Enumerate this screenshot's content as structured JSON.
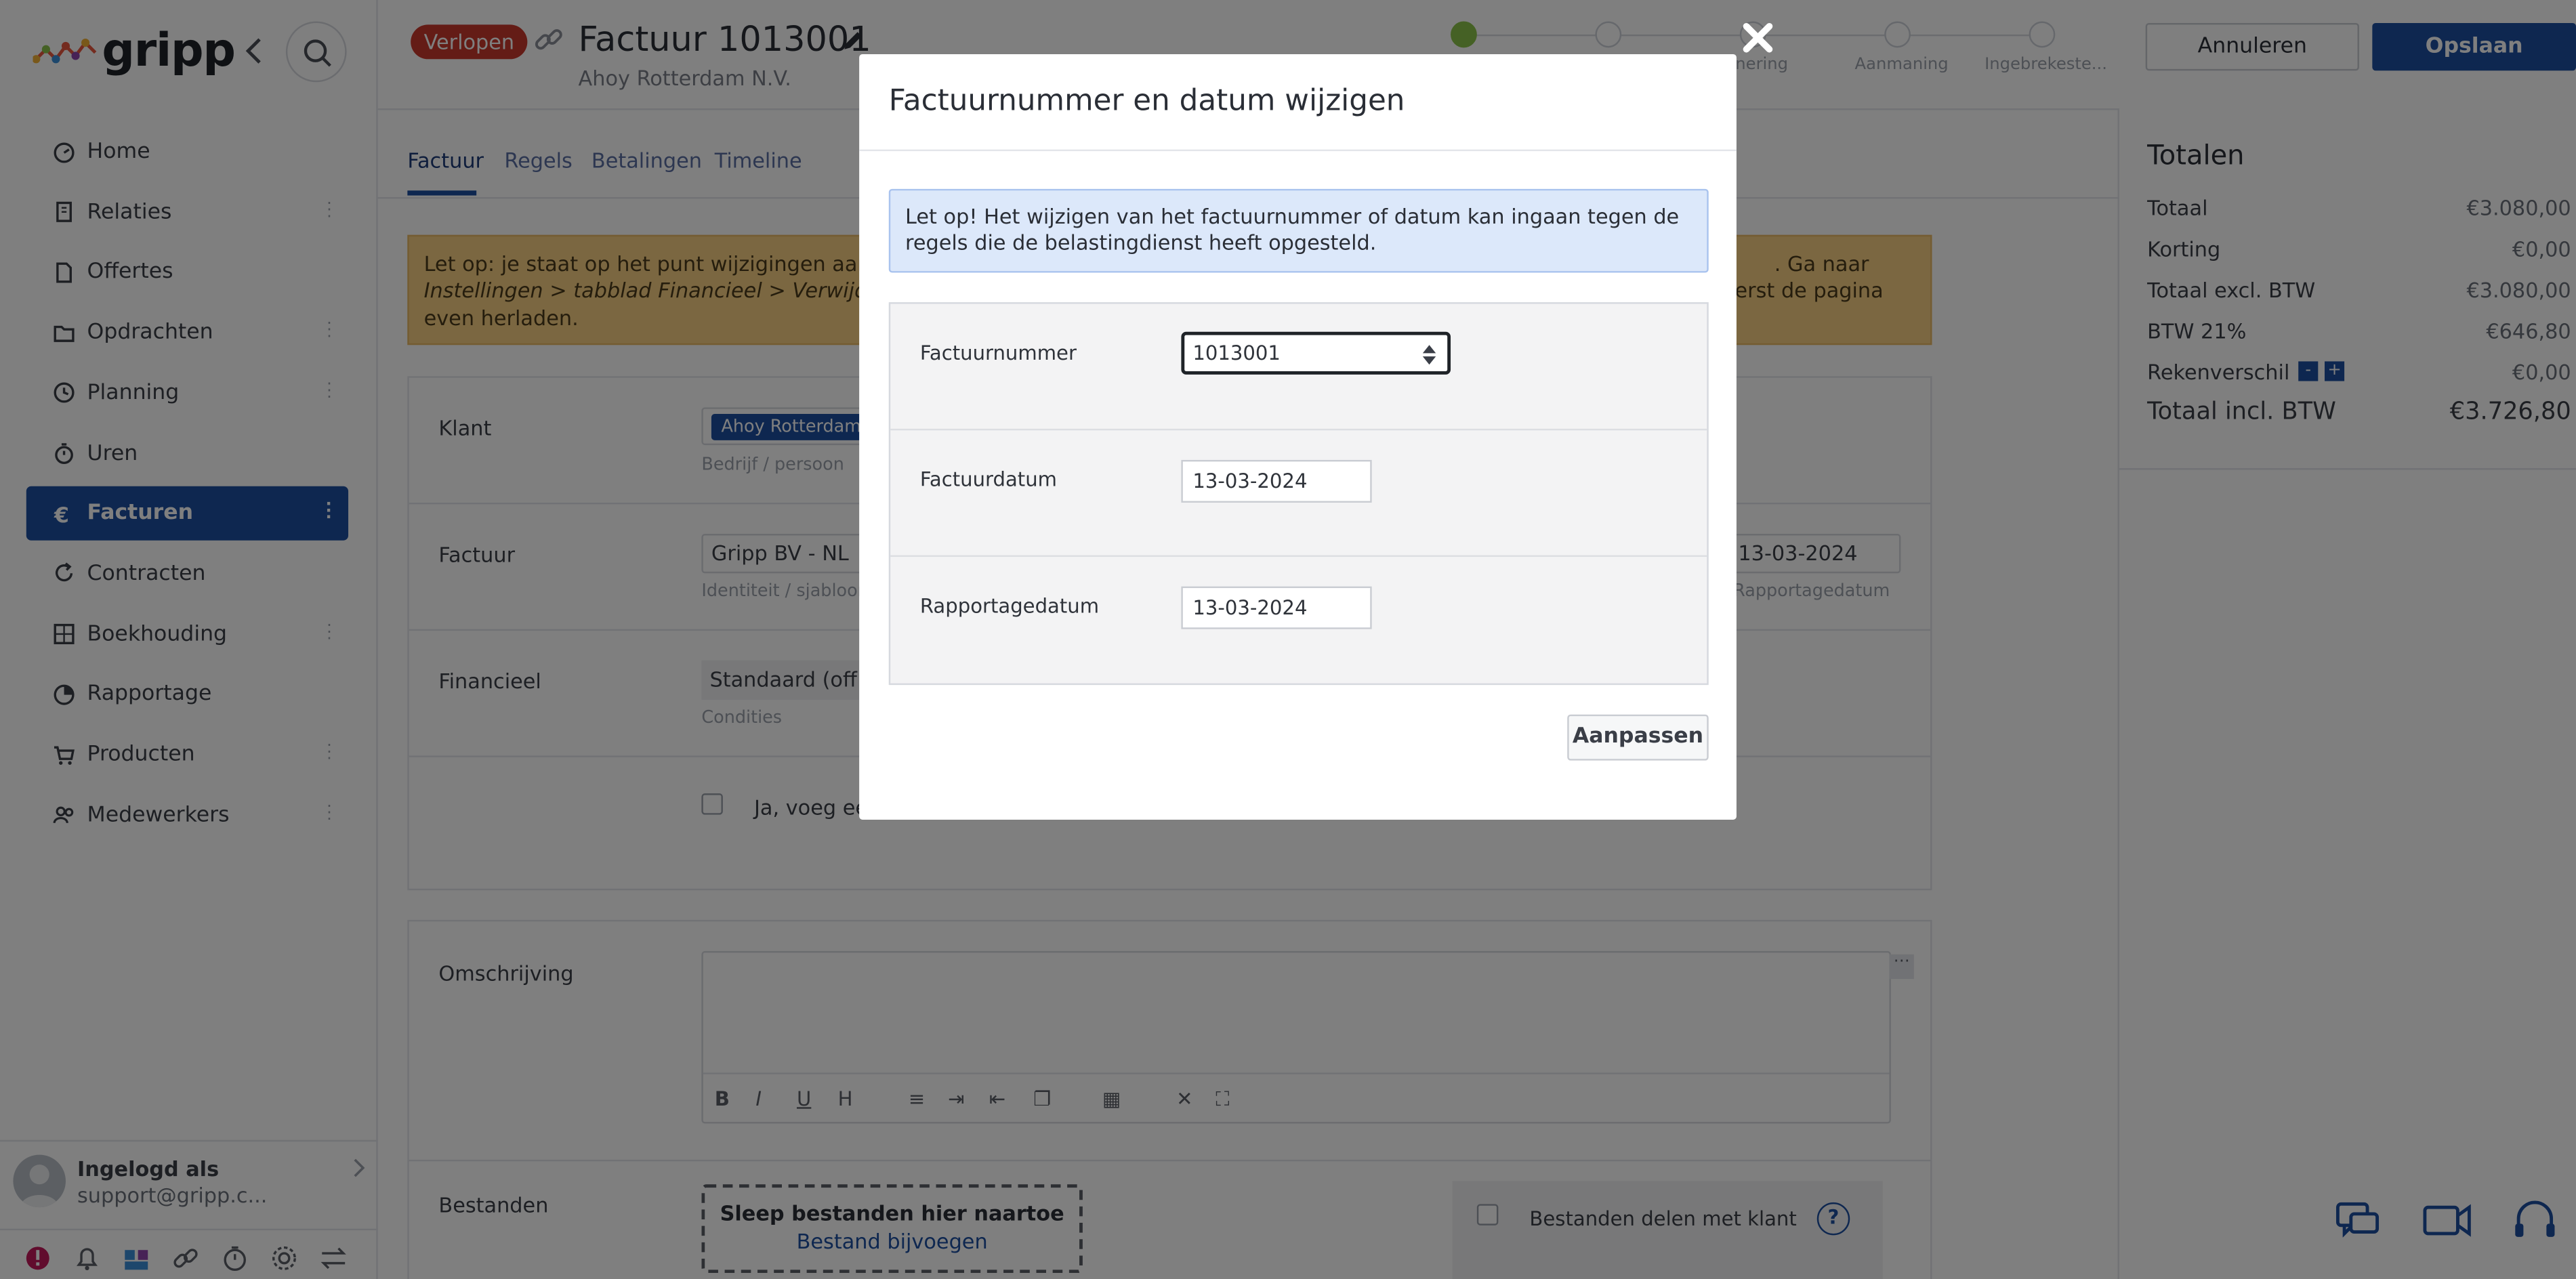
{
  "brand": {
    "logo_text": "gripp"
  },
  "sidebar": {
    "items": [
      {
        "label": "Home",
        "icon": "dashboard-icon",
        "menu": false
      },
      {
        "label": "Relaties",
        "icon": "building-icon",
        "menu": true
      },
      {
        "label": "Offertes",
        "icon": "document-icon",
        "menu": false
      },
      {
        "label": "Opdrachten",
        "icon": "folder-icon",
        "menu": true
      },
      {
        "label": "Planning",
        "icon": "clock-icon",
        "menu": true
      },
      {
        "label": "Uren",
        "icon": "stopwatch-icon",
        "menu": false
      },
      {
        "label": "Facturen",
        "icon": "euro-icon",
        "menu": true
      },
      {
        "label": "Contracten",
        "icon": "refresh-icon",
        "menu": false
      },
      {
        "label": "Boekhouding",
        "icon": "grid-icon",
        "menu": true
      },
      {
        "label": "Rapportage",
        "icon": "pie-chart-icon",
        "menu": false
      },
      {
        "label": "Producten",
        "icon": "cart-icon",
        "menu": true
      },
      {
        "label": "Medewerkers",
        "icon": "users-icon",
        "menu": true
      }
    ],
    "active": "Facturen",
    "user": {
      "title": "Ingelogd als",
      "email": "support@gripp.c..."
    }
  },
  "header": {
    "status_badge": "Verlopen",
    "title": "Factuur 1013001",
    "subtitle": "Ahoy Rotterdam N.V.",
    "cancel_label": "Annuleren",
    "save_label": "Opslaan",
    "steps": [
      "...inering",
      "Aanmaning",
      "Ingebrekeste..."
    ]
  },
  "tabs": [
    "Factuur",
    "Regels",
    "Betalingen",
    "Timeline"
  ],
  "warning": {
    "line1_left": "Let op: je staat op het punt wijzigingen aan te",
    "line1_right": ". Ga naar",
    "line2_left": "Instellingen > tabblad Financieel > Verwijdere",
    "line2_right": "erst de pagina",
    "line3": "even herladen."
  },
  "form": {
    "klant_label": "Klant",
    "klant_value": "Ahoy Rotterdam",
    "klant_sub": "Bedrijf / persoon",
    "factuur_label": "Factuur",
    "factuur_value": "Gripp BV - NL",
    "factuur_sub": "Identiteit / sjabloon",
    "factuur_date": "13-03-2024",
    "factuur_date_sub": "Rapportagedatum",
    "financieel_label": "Financieel",
    "financieel_value": "Standaard (off",
    "financieel_sub": "Condities",
    "checkbox_label": "Ja, voeg ee",
    "omschrijving_label": "Omschrijving",
    "bestanden_label": "Bestanden",
    "drop_title": "Sleep bestanden hier naartoe",
    "drop_link": "Bestand bijvoegen",
    "share_label": "Bestanden delen met klant"
  },
  "totals": {
    "title": "Totalen",
    "rows": [
      {
        "label": "Totaal",
        "value": "€3.080,00"
      },
      {
        "label": "Korting",
        "value": "€0,00"
      },
      {
        "label": "Totaal excl. BTW",
        "value": "€3.080,00"
      },
      {
        "label": "BTW 21%",
        "value": "€646,80"
      },
      {
        "label": "Rekenverschil",
        "value": "€0,00"
      }
    ],
    "grand_label": "Totaal incl. BTW",
    "grand_value": "€3.726,80",
    "minus": "-",
    "plus": "+"
  },
  "modal": {
    "title": "Factuurnummer en datum wijzigen",
    "notice": "Let op! Het wijzigen van het factuurnummer of datum kan ingaan tegen de regels die de belastingdienst heeft opgesteld.",
    "fields": [
      {
        "label": "Factuurnummer",
        "value": "1013001"
      },
      {
        "label": "Factuurdatum",
        "value": "13-03-2024"
      },
      {
        "label": "Rapportagedatum",
        "value": "13-03-2024"
      }
    ],
    "submit_label": "Aanpassen"
  },
  "colors": {
    "primary": "#1d4fa0",
    "badge": "#c9392c",
    "warning_bg": "#f6ce83",
    "notice_bg": "#dce8fa",
    "step_done": "#8bc34a"
  }
}
